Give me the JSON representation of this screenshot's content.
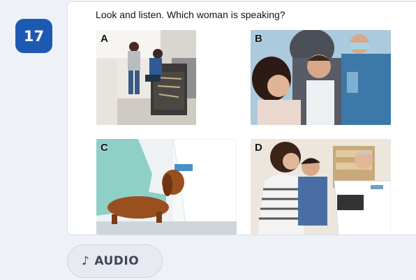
{
  "question": {
    "number": "17",
    "prompt": "Look and listen. Which woman is speaking?",
    "options": [
      {
        "letter": "A"
      },
      {
        "letter": "B"
      },
      {
        "letter": "C"
      },
      {
        "letter": "D"
      }
    ]
  },
  "audio_button": {
    "label": "AUDIO",
    "icon": "music-note-icon"
  }
}
